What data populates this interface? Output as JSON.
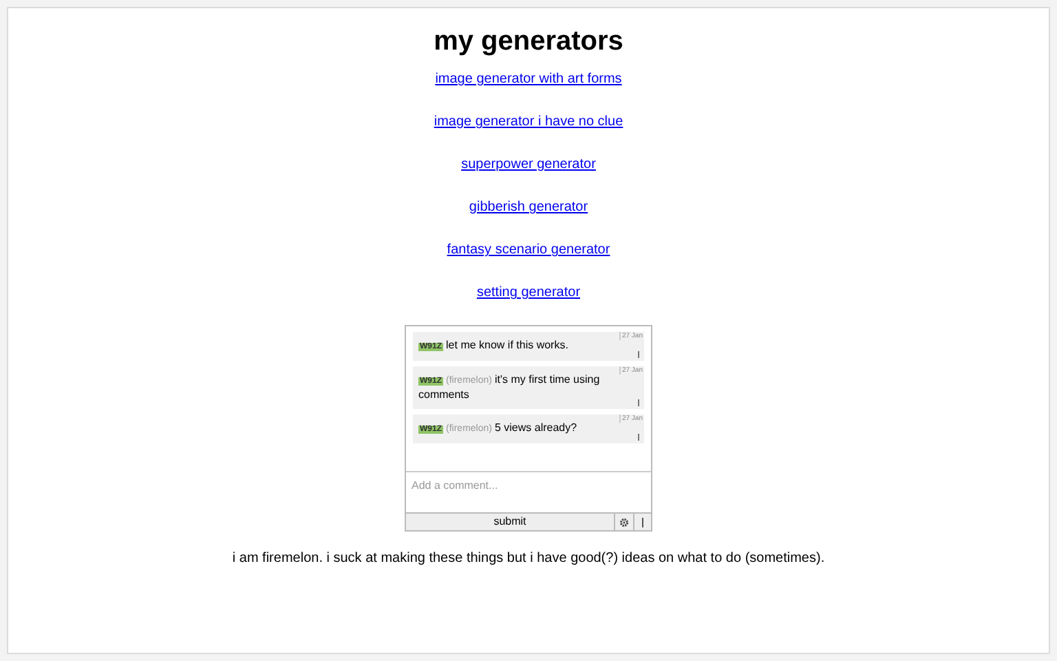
{
  "title": "my generators",
  "links": [
    "image generator with art forms",
    "image generator i have no clue",
    "superpower generator",
    "gibberish generator",
    "fantasy scenario generator",
    "setting generator"
  ],
  "comments": [
    {
      "user": "W91Z",
      "text": "let me know if this works.",
      "date": "27 Jan"
    },
    {
      "user": "W91Z",
      "nickname": "(firemelon)",
      "text": "it's my first time using comments",
      "date": "27 Jan"
    },
    {
      "user": "W91Z",
      "nickname": "(firemelon)",
      "text": "5 views already?",
      "date": "27 Jan"
    }
  ],
  "comment_field": {
    "placeholder": "Add a comment..."
  },
  "submit_label": "submit",
  "bio": "i am firemelon. i suck at making these things but i have good(?) ideas on what to do (sometimes)."
}
